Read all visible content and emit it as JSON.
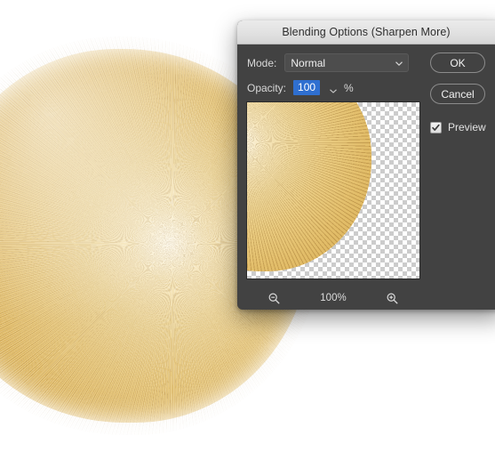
{
  "canvas": {
    "background_color": "#ffffff",
    "artwork_name": "furry-radial-blob",
    "artwork_colors": [
      "#fdf8ea",
      "#eed79b",
      "#e8c97e",
      "#d9b159"
    ]
  },
  "dialog": {
    "title": "Blending Options (Sharpen More)",
    "background_color": "#424242",
    "titlebar_color": "#e2e2e2",
    "mode": {
      "label": "Mode:",
      "value": "Normal",
      "chevron_icon": "chevron-down-icon"
    },
    "opacity": {
      "label": "Opacity:",
      "value": "100",
      "unit": "%",
      "selection_color": "#2f6fd0",
      "chevron_icon": "chevron-down-icon"
    },
    "preview_pane": {
      "checkerboard": true,
      "zoom_out_icon": "magnifier-minus-icon",
      "zoom_level": "100%",
      "zoom_in_icon": "magnifier-plus-icon"
    },
    "buttons": {
      "ok": "OK",
      "cancel": "Cancel"
    },
    "preview_checkbox": {
      "label": "Preview",
      "checked": true,
      "check_icon": "checkmark-icon"
    }
  }
}
